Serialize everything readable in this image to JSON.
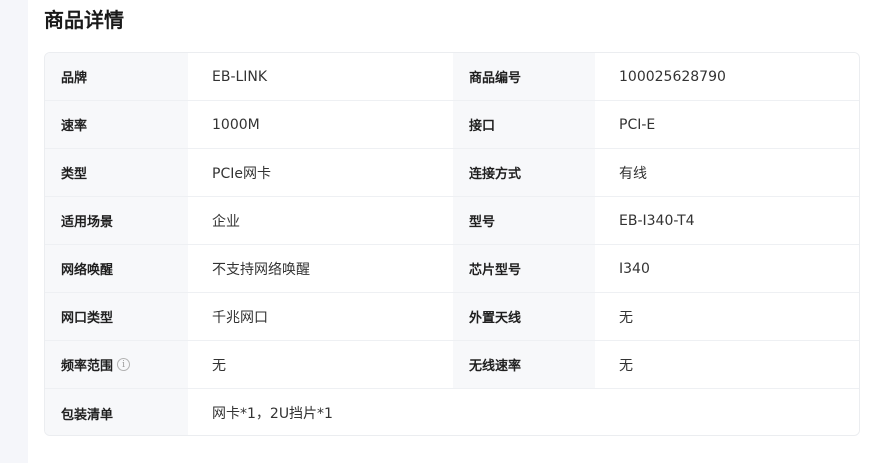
{
  "section": {
    "title": "商品详情"
  },
  "rows": [
    {
      "label_left": "品牌",
      "value_left": "EB-LINK",
      "label_right": "商品编号",
      "value_right": "100025628790"
    },
    {
      "label_left": "速率",
      "value_left": "1000M",
      "label_right": "接口",
      "value_right": "PCI-E"
    },
    {
      "label_left": "类型",
      "value_left": "PCIe网卡",
      "label_right": "连接方式",
      "value_right": "有线"
    },
    {
      "label_left": "适用场景",
      "value_left": "企业",
      "label_right": "型号",
      "value_right": "EB-I340-T4"
    },
    {
      "label_left": "网络唤醒",
      "value_left": "不支持网络唤醒",
      "label_right": "芯片型号",
      "value_right": "I340"
    },
    {
      "label_left": "网口类型",
      "value_left": "千兆网口",
      "label_right": "外置天线",
      "value_right": "无"
    },
    {
      "label_left": "频率范围",
      "info_icon": "i",
      "value_left": "无",
      "label_right": "无线速率",
      "value_right": "无"
    },
    {
      "label_left": "包装清单",
      "value_full": "网卡*1，2U挡片*1"
    }
  ],
  "icons": {
    "info": "info-circle-icon"
  },
  "colors": {
    "label_bg": "#f7f8fa",
    "border": "#ebedf0",
    "sidebar_bg": "#f5f6fa"
  }
}
